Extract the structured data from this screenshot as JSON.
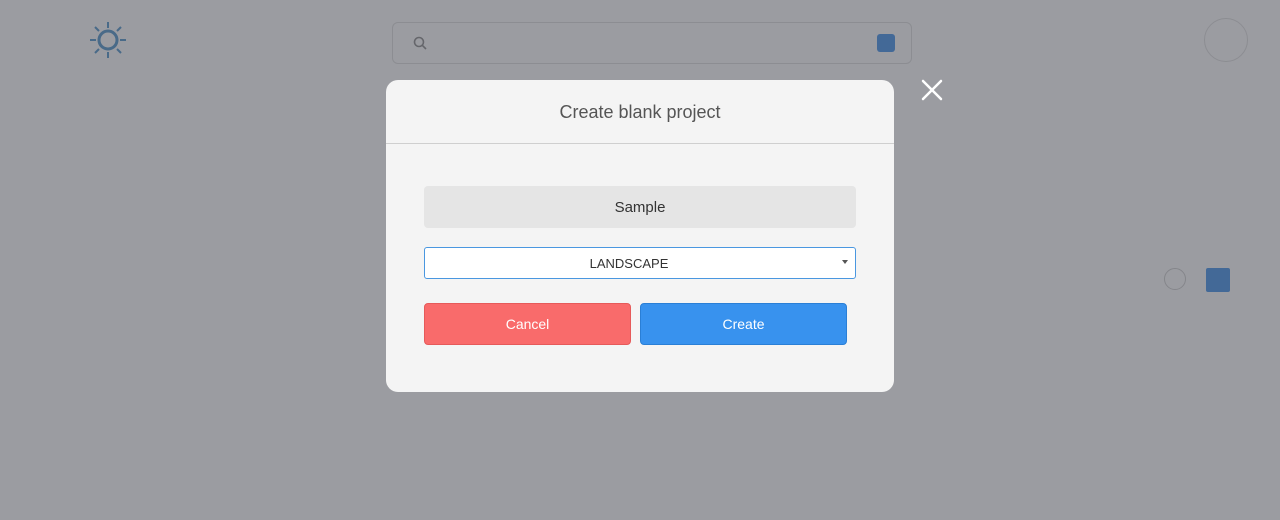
{
  "background": {
    "logo": {
      "left_text": "",
      "right_text": ""
    },
    "search": {
      "placeholder": "",
      "filter_label": ""
    },
    "user": {
      "name": ""
    },
    "breadcrumb": {
      "parent": "",
      "current": ""
    },
    "filters_label": "",
    "results_count": "",
    "add_row": {
      "prefix": "",
      "link": ""
    },
    "sort": {
      "label": "",
      "value": "",
      "direction": ""
    }
  },
  "modal": {
    "title": "Create blank project",
    "name_value": "Sample",
    "orientation_selected": "LANDSCAPE",
    "cancel_label": "Cancel",
    "create_label": "Create"
  },
  "colors": {
    "overlay": "#484a54",
    "cancel": "#f96b6b",
    "create": "#3892ee",
    "accent": "#3d8fe8"
  },
  "icons": {
    "close": "close-icon",
    "caret": "caret-down-icon",
    "search": "search-icon"
  }
}
